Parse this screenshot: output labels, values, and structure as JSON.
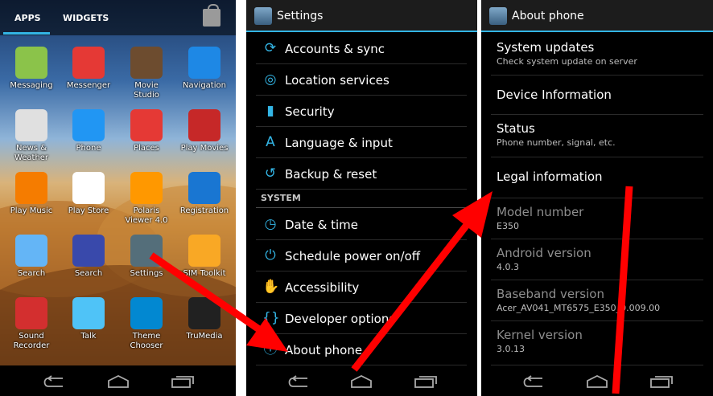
{
  "drawer": {
    "tabs": [
      "APPS",
      "WIDGETS"
    ],
    "apps": [
      {
        "label": "Messaging",
        "icon": "messaging-icon",
        "color": "#8bc34a"
      },
      {
        "label": "Messenger",
        "icon": "messenger-icon",
        "color": "#e53935"
      },
      {
        "label": "Movie\nStudio",
        "icon": "movie-studio-icon",
        "color": "#6d4c2f"
      },
      {
        "label": "Navigation",
        "icon": "navigation-icon",
        "color": "#1e88e5"
      },
      {
        "label": "News &\nWeather",
        "icon": "news-weather-icon",
        "color": "#e0e0e0"
      },
      {
        "label": "Phone",
        "icon": "phone-icon",
        "color": "#2196f3"
      },
      {
        "label": "Places",
        "icon": "places-icon",
        "color": "#e53935"
      },
      {
        "label": "Play Movies",
        "icon": "play-movies-icon",
        "color": "#c62828"
      },
      {
        "label": "Play Music",
        "icon": "play-music-icon",
        "color": "#f57c00"
      },
      {
        "label": "Play Store",
        "icon": "play-store-icon",
        "color": "#ffffff"
      },
      {
        "label": "Polaris\nViewer 4.0",
        "icon": "polaris-viewer-icon",
        "color": "#ff9800"
      },
      {
        "label": "Registration",
        "icon": "registration-icon",
        "color": "#1976d2"
      },
      {
        "label": "Search",
        "icon": "search-icon",
        "color": "#64b5f6"
      },
      {
        "label": "Search",
        "icon": "google-search-icon",
        "color": "#3949ab"
      },
      {
        "label": "Settings",
        "icon": "settings-icon",
        "color": "#546e7a"
      },
      {
        "label": "SIM Toolkit",
        "icon": "sim-toolkit-icon",
        "color": "#f9a825"
      },
      {
        "label": "Sound\nRecorder",
        "icon": "sound-recorder-icon",
        "color": "#d32f2f"
      },
      {
        "label": "Talk",
        "icon": "talk-icon",
        "color": "#4fc3f7"
      },
      {
        "label": "Theme\nChooser",
        "icon": "theme-chooser-icon",
        "color": "#0288d1"
      },
      {
        "label": "TruMedia",
        "icon": "trumedia-icon",
        "color": "#212121"
      }
    ]
  },
  "settings": {
    "title": "Settings",
    "items": [
      {
        "label": "Accounts & sync",
        "glyph": "⟳"
      },
      {
        "label": "Location services",
        "glyph": "◎"
      },
      {
        "label": "Security",
        "glyph": "▮"
      },
      {
        "label": "Language & input",
        "glyph": "A"
      },
      {
        "label": "Backup & reset",
        "glyph": "↺"
      }
    ],
    "section_header": "SYSTEM",
    "system_items": [
      {
        "label": "Date & time",
        "glyph": "◷"
      },
      {
        "label": "Schedule power on/off",
        "glyph": "⏻"
      },
      {
        "label": "Accessibility",
        "glyph": "✋"
      },
      {
        "label": "Developer options",
        "glyph": "{}"
      },
      {
        "label": "About phone",
        "glyph": "ⓘ"
      }
    ]
  },
  "about": {
    "title": "About phone",
    "items": [
      {
        "title": "System updates",
        "sub": "Check system update on server"
      },
      {
        "title": "Device Information",
        "sub": ""
      },
      {
        "title": "Status",
        "sub": "Phone number, signal, etc."
      },
      {
        "title": "Legal information",
        "sub": ""
      },
      {
        "title": "Model number",
        "sub": "E350"
      },
      {
        "title": "Android version",
        "sub": "4.0.3"
      },
      {
        "title": "Baseband version",
        "sub": "Acer_AV041_MT6575_E350_0.009.00"
      },
      {
        "title": "Kernel version",
        "sub": "3.0.13"
      }
    ]
  },
  "colors": {
    "accent": "#33b5e5",
    "arrow": "#ff0000"
  }
}
